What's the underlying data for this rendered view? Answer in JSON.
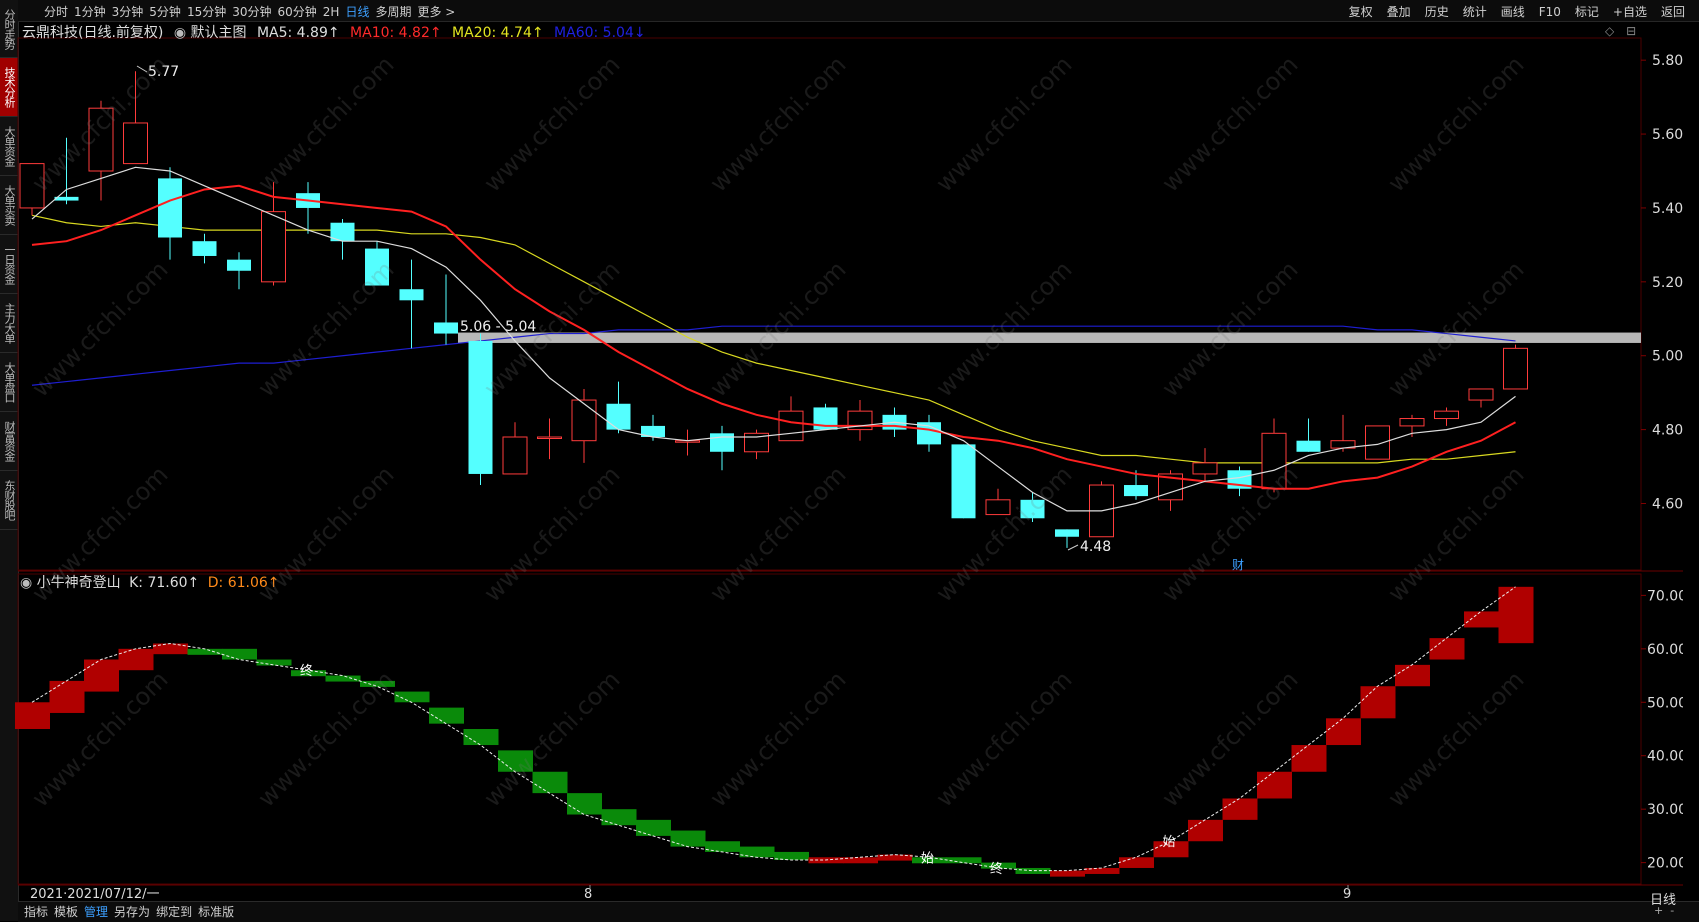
{
  "toolbar": {
    "periods": [
      "分时",
      "1分钟",
      "3分钟",
      "5分钟",
      "15分钟",
      "30分钟",
      "60分钟",
      "2H",
      "日线",
      "多周期",
      "更多 >"
    ],
    "active_period": "日线",
    "right_buttons": [
      "复权",
      "叠加",
      "历史",
      "统计",
      "画线",
      "F10",
      "标记",
      "+自选",
      "返回"
    ]
  },
  "left_tabs": [
    "分时走势",
    "技术分析",
    "大单资金",
    "大单买卖",
    "一日资金",
    "主力大单",
    "大单盘口",
    "财富资金",
    "东财股吧"
  ],
  "left_tab_active": 1,
  "main_header": {
    "stock": "云鼎科技(日线.前复权)",
    "theme": "默认主图",
    "ma5": "MA5: 4.89↑",
    "ma10": "MA10: 4.82↑",
    "ma20": "MA20: 4.74↑",
    "ma60": "MA60: 5.04↓"
  },
  "sub_header": {
    "indicator": "小牛神奇登山",
    "k": "K: 71.60↑",
    "d": "D: 61.06↑"
  },
  "price_axis": [
    "5.80",
    "5.60",
    "5.40",
    "5.20",
    "5.00",
    "4.80",
    "4.60"
  ],
  "sub_axis": [
    "70.00",
    "60.00",
    "50.00",
    "40.00",
    "30.00",
    "20.00"
  ],
  "annotations": {
    "high": "5.77",
    "low": "4.48",
    "range": "5.06 - 5.04",
    "cai": "财",
    "start": "始",
    "end": "终"
  },
  "date_axis": {
    "start": "2021·2021/07/12/一",
    "m8": "8",
    "m9": "9"
  },
  "bottom_bar": [
    "指标",
    "模板",
    "管理",
    "另存为",
    "绑定到",
    "标准版"
  ],
  "bottom_active": "管理",
  "period_label": "日线",
  "watermark": "www.cfchi.com",
  "colors": {
    "up": "#ff3b3b",
    "down": "#54ffff",
    "ma5": "#dddddd",
    "ma10": "#ff2020",
    "ma20": "#d8d820",
    "ma60": "#1e1ed2",
    "rise_block": "#b00000",
    "fall_block": "#0a8a0a"
  },
  "chart_data": {
    "type": "candlestick",
    "price_ylim": [
      4.42,
      5.86
    ],
    "candles": [
      {
        "o": 5.4,
        "h": 5.52,
        "l": 5.38,
        "c": 5.52
      },
      {
        "o": 5.43,
        "h": 5.59,
        "l": 5.41,
        "c": 5.42
      },
      {
        "o": 5.5,
        "h": 5.69,
        "l": 5.42,
        "c": 5.67
      },
      {
        "o": 5.52,
        "h": 5.77,
        "l": 5.52,
        "c": 5.63
      },
      {
        "o": 5.48,
        "h": 5.51,
        "l": 5.26,
        "c": 5.32
      },
      {
        "o": 5.31,
        "h": 5.33,
        "l": 5.25,
        "c": 5.27
      },
      {
        "o": 5.26,
        "h": 5.28,
        "l": 5.18,
        "c": 5.23
      },
      {
        "o": 5.2,
        "h": 5.47,
        "l": 5.19,
        "c": 5.39
      },
      {
        "o": 5.44,
        "h": 5.47,
        "l": 5.33,
        "c": 5.4
      },
      {
        "o": 5.36,
        "h": 5.37,
        "l": 5.26,
        "c": 5.31
      },
      {
        "o": 5.29,
        "h": 5.31,
        "l": 5.2,
        "c": 5.19
      },
      {
        "o": 5.18,
        "h": 5.26,
        "l": 5.02,
        "c": 5.15
      },
      {
        "o": 5.09,
        "h": 5.22,
        "l": 5.03,
        "c": 5.06
      },
      {
        "o": 5.04,
        "h": 5.06,
        "l": 4.65,
        "c": 4.68
      },
      {
        "o": 4.68,
        "h": 4.82,
        "l": 4.68,
        "c": 4.78
      },
      {
        "o": 4.78,
        "h": 4.83,
        "l": 4.72,
        "c": 4.78
      },
      {
        "o": 4.77,
        "h": 4.91,
        "l": 4.71,
        "c": 4.88
      },
      {
        "o": 4.87,
        "h": 4.93,
        "l": 4.79,
        "c": 4.8
      },
      {
        "o": 4.81,
        "h": 4.84,
        "l": 4.77,
        "c": 4.78
      },
      {
        "o": 4.77,
        "h": 4.8,
        "l": 4.73,
        "c": 4.77
      },
      {
        "o": 4.79,
        "h": 4.81,
        "l": 4.69,
        "c": 4.74
      },
      {
        "o": 4.74,
        "h": 4.8,
        "l": 4.72,
        "c": 4.79
      },
      {
        "o": 4.77,
        "h": 4.89,
        "l": 4.77,
        "c": 4.85
      },
      {
        "o": 4.86,
        "h": 4.87,
        "l": 4.8,
        "c": 4.8
      },
      {
        "o": 4.8,
        "h": 4.88,
        "l": 4.77,
        "c": 4.85
      },
      {
        "o": 4.84,
        "h": 4.86,
        "l": 4.78,
        "c": 4.8
      },
      {
        "o": 4.82,
        "h": 4.84,
        "l": 4.74,
        "c": 4.76
      },
      {
        "o": 4.76,
        "h": 4.76,
        "l": 4.56,
        "c": 4.56
      },
      {
        "o": 4.57,
        "h": 4.64,
        "l": 4.57,
        "c": 4.61
      },
      {
        "o": 4.61,
        "h": 4.63,
        "l": 4.55,
        "c": 4.56
      },
      {
        "o": 4.53,
        "h": 4.53,
        "l": 4.48,
        "c": 4.51
      },
      {
        "o": 4.51,
        "h": 4.66,
        "l": 4.51,
        "c": 4.65
      },
      {
        "o": 4.65,
        "h": 4.69,
        "l": 4.61,
        "c": 4.62
      },
      {
        "o": 4.61,
        "h": 4.69,
        "l": 4.58,
        "c": 4.68
      },
      {
        "o": 4.68,
        "h": 4.75,
        "l": 4.66,
        "c": 4.71
      },
      {
        "o": 4.69,
        "h": 4.7,
        "l": 4.62,
        "c": 4.64
      },
      {
        "o": 4.64,
        "h": 4.83,
        "l": 4.63,
        "c": 4.79
      },
      {
        "o": 4.77,
        "h": 4.83,
        "l": 4.74,
        "c": 4.74
      },
      {
        "o": 4.75,
        "h": 4.84,
        "l": 4.74,
        "c": 4.77
      },
      {
        "o": 4.72,
        "h": 4.81,
        "l": 4.72,
        "c": 4.81
      },
      {
        "o": 4.81,
        "h": 4.84,
        "l": 4.78,
        "c": 4.83
      },
      {
        "o": 4.83,
        "h": 4.86,
        "l": 4.81,
        "c": 4.85
      },
      {
        "o": 4.88,
        "h": 4.91,
        "l": 4.86,
        "c": 4.91
      },
      {
        "o": 4.91,
        "h": 5.03,
        "l": 4.91,
        "c": 5.02
      }
    ],
    "ma5": [
      5.37,
      5.45,
      5.48,
      5.51,
      5.5,
      5.46,
      5.42,
      5.38,
      5.34,
      5.31,
      5.31,
      5.29,
      5.24,
      5.15,
      5.04,
      4.94,
      4.87,
      4.8,
      4.78,
      4.77,
      4.78,
      4.78,
      4.79,
      4.8,
      4.81,
      4.82,
      4.81,
      4.77,
      4.7,
      4.63,
      4.58,
      4.58,
      4.6,
      4.63,
      4.66,
      4.67,
      4.69,
      4.73,
      4.75,
      4.76,
      4.79,
      4.8,
      4.82,
      4.89
    ],
    "ma10": [
      5.3,
      5.31,
      5.34,
      5.38,
      5.42,
      5.45,
      5.46,
      5.43,
      5.42,
      5.41,
      5.4,
      5.39,
      5.35,
      5.26,
      5.18,
      5.12,
      5.07,
      5.01,
      4.96,
      4.91,
      4.87,
      4.84,
      4.82,
      4.81,
      4.81,
      4.81,
      4.8,
      4.78,
      4.77,
      4.75,
      4.72,
      4.7,
      4.68,
      4.67,
      4.66,
      4.65,
      4.64,
      4.64,
      4.66,
      4.67,
      4.7,
      4.74,
      4.77,
      4.82
    ],
    "ma20": [
      5.38,
      5.36,
      5.35,
      5.36,
      5.35,
      5.34,
      5.34,
      5.34,
      5.34,
      5.34,
      5.34,
      5.33,
      5.33,
      5.32,
      5.3,
      5.25,
      5.2,
      5.15,
      5.1,
      5.05,
      5.01,
      4.98,
      4.96,
      4.94,
      4.92,
      4.9,
      4.88,
      4.84,
      4.8,
      4.77,
      4.75,
      4.73,
      4.73,
      4.72,
      4.71,
      4.71,
      4.71,
      4.71,
      4.71,
      4.71,
      4.72,
      4.72,
      4.73,
      4.74
    ],
    "ma60": [
      4.92,
      4.93,
      4.94,
      4.95,
      4.96,
      4.97,
      4.98,
      4.98,
      4.99,
      5.0,
      5.01,
      5.02,
      5.03,
      5.04,
      5.05,
      5.06,
      5.06,
      5.07,
      5.07,
      5.07,
      5.08,
      5.08,
      5.08,
      5.08,
      5.08,
      5.08,
      5.08,
      5.08,
      5.08,
      5.08,
      5.08,
      5.08,
      5.08,
      5.08,
      5.08,
      5.08,
      5.08,
      5.08,
      5.08,
      5.07,
      5.07,
      5.06,
      5.05,
      5.04
    ],
    "highlight_range": [
      5.06,
      5.04
    ],
    "sub_ylim": [
      16,
      74
    ],
    "sub_k": [
      50,
      54,
      58,
      60,
      61,
      60,
      58,
      57,
      56,
      55,
      53,
      50,
      46,
      42,
      37,
      33,
      29,
      27,
      25,
      23,
      22,
      21,
      20.5,
      20.5,
      21,
      21.5,
      21,
      20,
      19,
      18.5,
      18.5,
      19,
      21,
      24,
      28,
      32,
      37,
      42,
      47,
      53,
      57,
      62,
      67,
      71.6
    ],
    "sub_d": [
      45,
      48,
      52,
      56,
      59,
      60,
      60,
      58,
      56,
      55,
      54,
      52,
      49,
      45,
      41,
      37,
      33,
      30,
      28,
      26,
      24,
      23,
      22,
      21,
      20.5,
      20.5,
      21,
      21,
      20,
      19,
      18,
      18.5,
      19,
      21,
      24,
      28,
      32,
      37,
      42,
      47,
      53,
      58,
      64,
      61.06
    ]
  }
}
